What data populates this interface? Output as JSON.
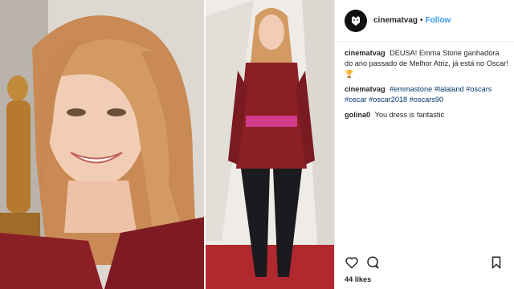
{
  "post": {
    "username": "cinematvag",
    "separator": "•",
    "follow_label": "Follow",
    "comments": [
      {
        "user": "cinematvag",
        "text": "DEUSA! Emma Stone ganhadora do ano passado de Melhor Atriz, já está no Oscar! 🏆"
      },
      {
        "user": "cinematvag",
        "tags": [
          "#emmastone",
          "#lalaland",
          "#oscars",
          "#oscar",
          "#oscar2018",
          "#oscars90"
        ]
      },
      {
        "user": "golina0",
        "text": "You dress is fantastic"
      }
    ],
    "likes_text": "44 likes",
    "icons": [
      "heart-icon",
      "comment-icon",
      "bookmark-icon"
    ],
    "colors": {
      "follow": "#3897f0",
      "hashtag": "#003569",
      "suit": "#8b1f26",
      "sash": "#d23a8a"
    }
  }
}
